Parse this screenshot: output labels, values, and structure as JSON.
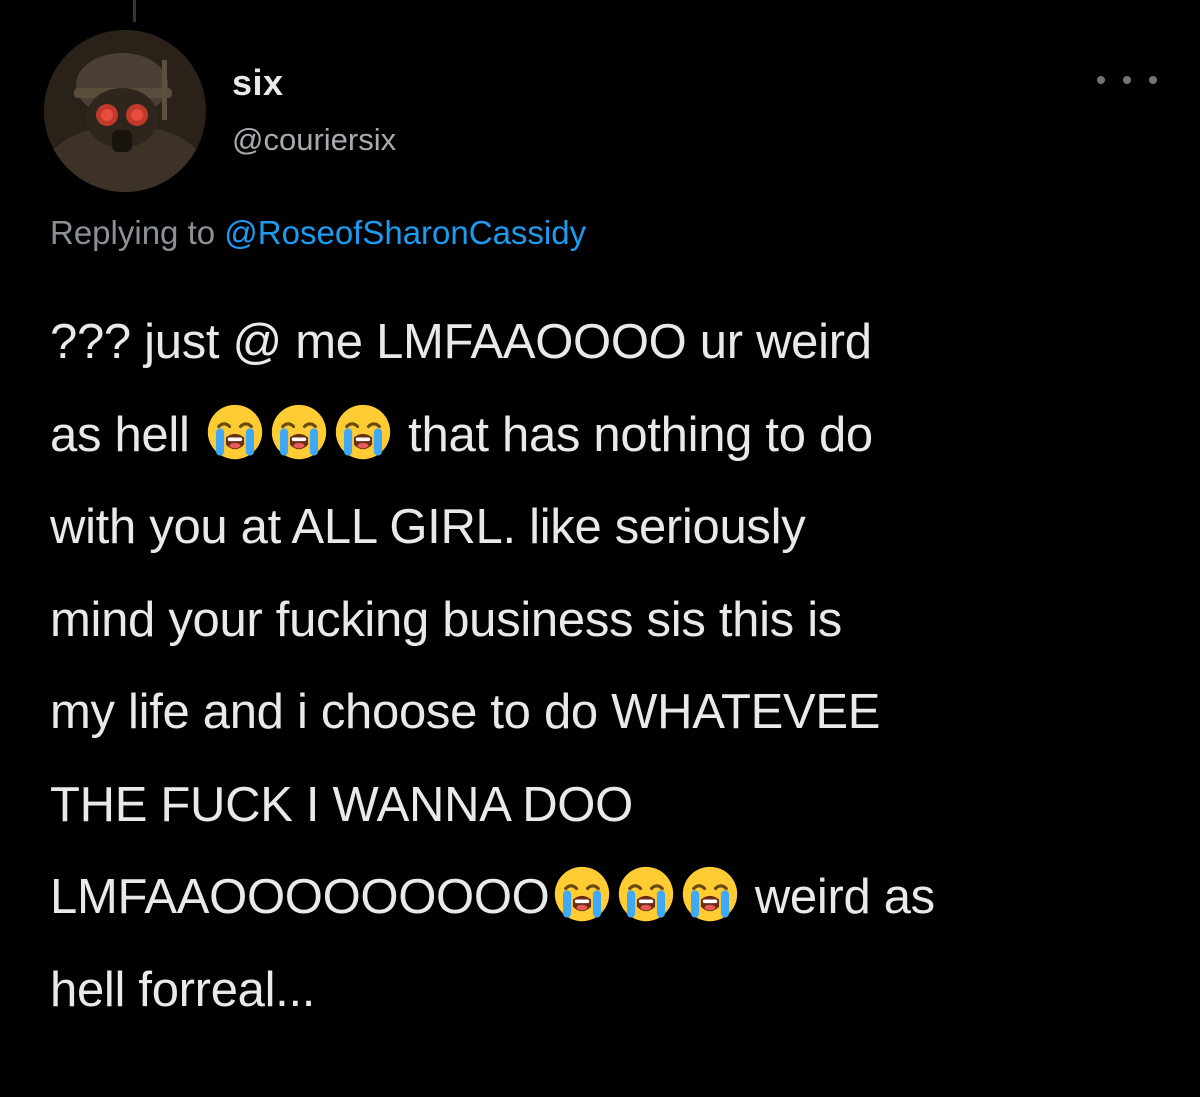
{
  "tweet": {
    "display_name": "six",
    "handle": "@couriersix",
    "reply_prefix": "Replying to",
    "reply_mention": "@RoseofSharonCassidy",
    "body_lines": [
      [
        "??? just @ me LMFAAOOOO ur weird"
      ],
      [
        "as hell ",
        "{emoji}",
        "{emoji}",
        "{emoji}",
        " that has nothing to do"
      ],
      [
        "with you at ALL GIRL. like seriously"
      ],
      [
        "mind your fucking business sis this is"
      ],
      [
        "my life and i choose to do WHATEVEE"
      ],
      [
        "THE FUCK I WANNA DOO"
      ],
      [
        "LMFAAOOOOOOOOO",
        "{emoji}",
        "{emoji}",
        "{emoji}",
        " weird as"
      ],
      [
        "hell forreal..."
      ]
    ],
    "emoji_name": "loudly-crying-face-icon",
    "more_icon": "more-options-icon",
    "avatar_icon": "avatar"
  },
  "colors": {
    "background": "#000000",
    "text_primary": "#e7e9ea",
    "text_secondary": "#8b9096",
    "mention": "#1d9bf0"
  }
}
